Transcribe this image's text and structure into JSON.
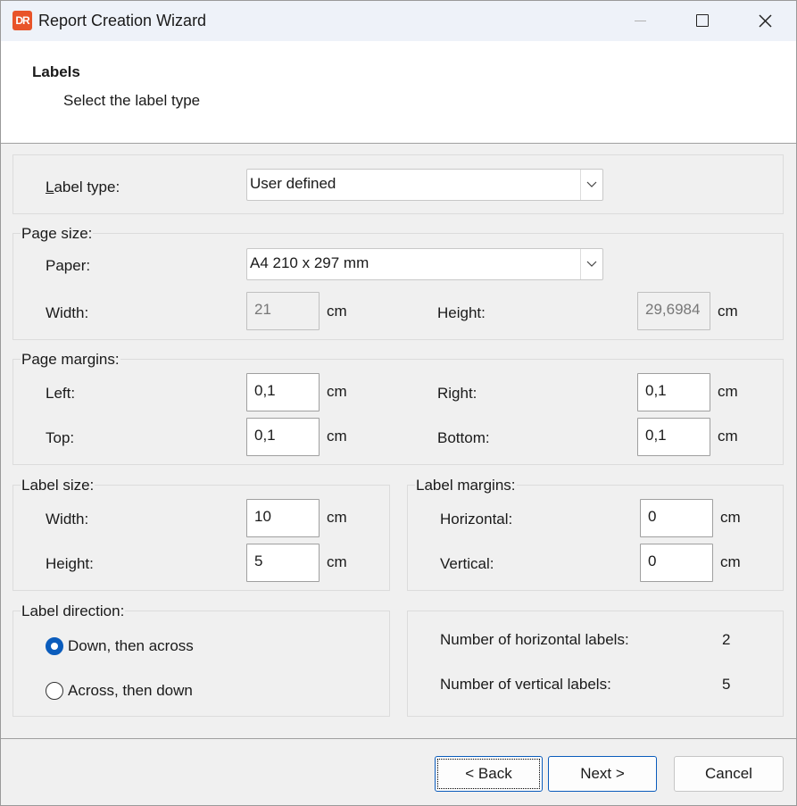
{
  "window": {
    "title": "Report Creation Wizard",
    "icon_text": "DR"
  },
  "header": {
    "title": "Labels",
    "subtitle": "Select the label type"
  },
  "label_type": {
    "label": "Label type:",
    "value": "User defined"
  },
  "page_size": {
    "group_label": "Page size:",
    "paper_label": "Paper:",
    "paper_value": "A4 210 x 297 mm",
    "width_label": "Width:",
    "width_value": "21",
    "width_unit": "cm",
    "height_label": "Height:",
    "height_value": "29,6984",
    "height_unit": "cm"
  },
  "page_margins": {
    "group_label": "Page margins:",
    "left_label": "Left:",
    "left_value": "0,1",
    "right_label": "Right:",
    "right_value": "0,1",
    "top_label": "Top:",
    "top_value": "0,1",
    "bottom_label": "Bottom:",
    "bottom_value": "0,1",
    "unit": "cm"
  },
  "label_size": {
    "group_label": "Label size:",
    "width_label": "Width:",
    "width_value": "10",
    "height_label": "Height:",
    "height_value": "5",
    "unit": "cm"
  },
  "label_margins": {
    "group_label": "Label margins:",
    "horizontal_label": "Horizontal:",
    "horizontal_value": "0",
    "vertical_label": "Vertical:",
    "vertical_value": "0",
    "unit": "cm"
  },
  "label_direction": {
    "group_label": "Label direction:",
    "option_down": "Down, then across",
    "option_across": "Across, then down",
    "selected": "Down, then across"
  },
  "summary": {
    "horizontal_label": "Number of horizontal labels:",
    "horizontal_count": "2",
    "vertical_label": "Number of vertical labels:",
    "vertical_count": "5"
  },
  "buttons": {
    "back": "< Back",
    "next": "Next >",
    "cancel": "Cancel"
  },
  "colors": {
    "accent": "#0b5cbc",
    "app_icon": "#e8542a"
  }
}
